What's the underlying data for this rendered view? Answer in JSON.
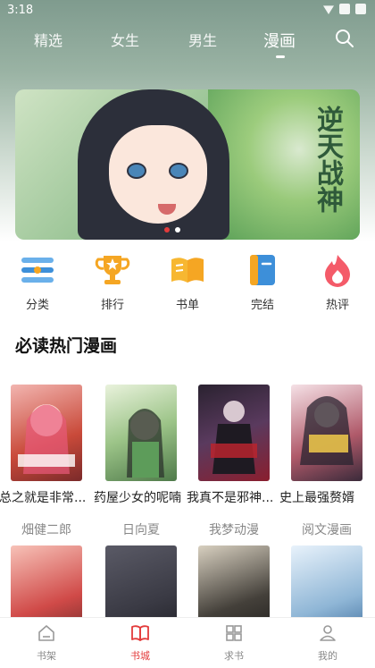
{
  "status": {
    "time": "3:18"
  },
  "nav": {
    "tabs": [
      {
        "label": "精选"
      },
      {
        "label": "女生"
      },
      {
        "label": "男生"
      },
      {
        "label": "漫画"
      }
    ],
    "active_tab": "漫画"
  },
  "banner": {
    "art_title": "逆天战神",
    "dot_count": 2,
    "active_dot": 0
  },
  "categories": [
    {
      "label": "分类",
      "icon": "list-icon"
    },
    {
      "label": "排行",
      "icon": "trophy-icon"
    },
    {
      "label": "书单",
      "icon": "book-open-icon"
    },
    {
      "label": "完结",
      "icon": "bookmark-icon"
    },
    {
      "label": "热评",
      "icon": "flame-icon"
    }
  ],
  "section": {
    "title": "必读热门漫画"
  },
  "comics": [
    {
      "title": "总之就是非常...",
      "author": "畑健二郎",
      "cover_color": "#c94a3a"
    },
    {
      "title": "药屋少女的呢喃",
      "author": "日向夏",
      "cover_color": "#7aa66a"
    },
    {
      "title": "我真不是邪神...",
      "author": "我梦动漫",
      "cover_color": "#5a3a5e"
    },
    {
      "title": "史上最强赘婿",
      "author": "阅文漫画",
      "cover_color": "#b05a6a"
    }
  ],
  "comics_row2": [
    {
      "cover_color": "#d04a48"
    },
    {
      "cover_color": "#3a3a44"
    },
    {
      "cover_color": "#44403a"
    },
    {
      "cover_color": "#8fb6d6"
    }
  ],
  "tabbar": [
    {
      "label": "书架",
      "icon": "home-icon"
    },
    {
      "label": "书城",
      "icon": "book-icon"
    },
    {
      "label": "求书",
      "icon": "grid-icon"
    },
    {
      "label": "我的",
      "icon": "user-icon"
    }
  ],
  "tabbar_active": "书城",
  "colors": {
    "accent": "#e33b3b",
    "banner_bg": "#9fc79a"
  }
}
